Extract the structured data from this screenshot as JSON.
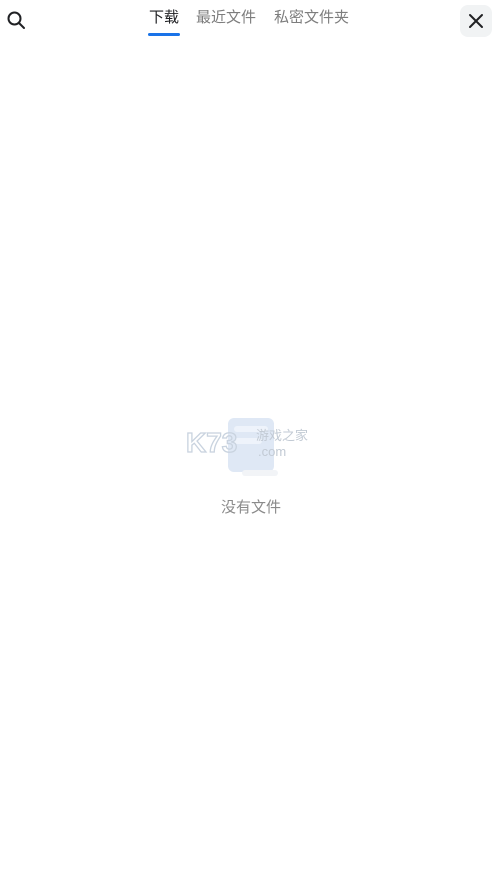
{
  "header": {
    "tabs": [
      {
        "label": "下载",
        "active": true
      },
      {
        "label": "最近文件",
        "active": false
      },
      {
        "label": "私密文件夹",
        "active": false
      }
    ],
    "search_icon": "search-icon",
    "close_icon": "close-icon"
  },
  "empty_state": {
    "message": "没有文件",
    "watermark_logo_text": "K73 游戏之家 .com"
  },
  "colors": {
    "accent": "#1a73e8",
    "tab_inactive": "#7d7d7d",
    "tab_active": "#202124",
    "empty_text": "#8a8a8a"
  }
}
